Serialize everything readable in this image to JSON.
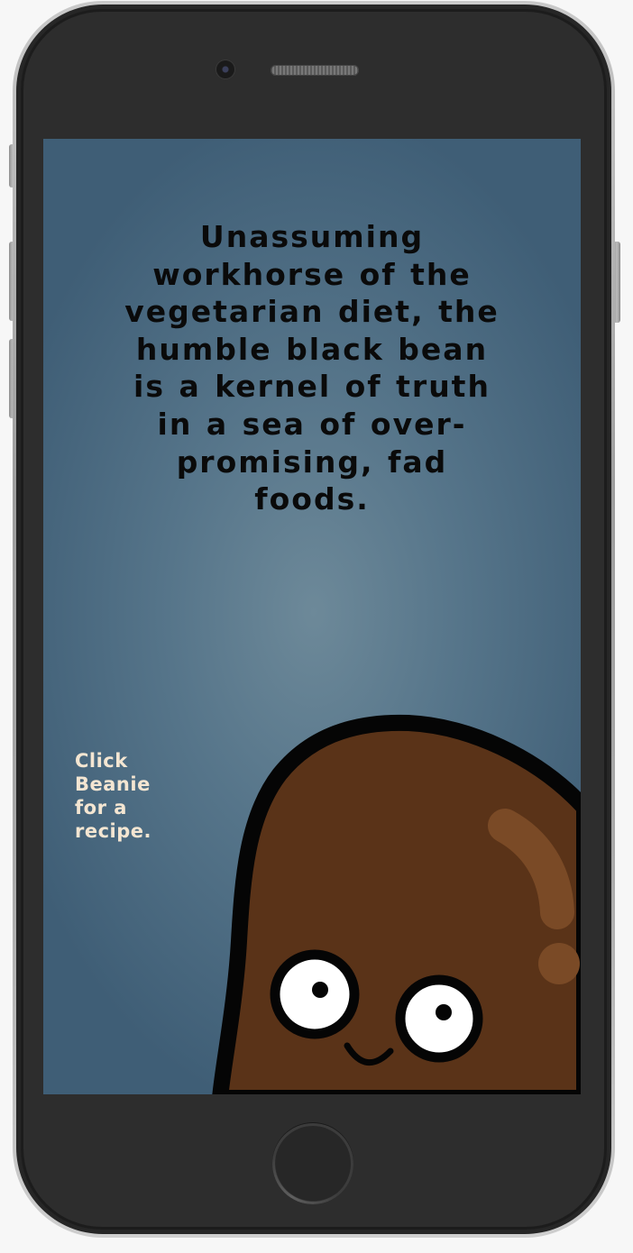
{
  "device": {
    "type": "phone-mockup"
  },
  "screen": {
    "quote_text": "Unassuming workhorse of the vegetarian diet, the humble black bean is a kernel of truth in a sea of over-promising, fad foods.",
    "hint_text": "Click Beanie for a recipe.",
    "colors": {
      "background_center": "#6d8999",
      "background_edge": "#3f5e76",
      "quote_text": "#0a0a0a",
      "hint_text": "#f4e6d2",
      "bean_body": "#5a3318",
      "bean_outline": "#050505",
      "bean_highlight": "#7a4a26"
    }
  },
  "icons": {
    "beanie": "beanie-character-icon",
    "camera": "front-camera-icon",
    "speaker": "earpiece-speaker-icon",
    "home": "home-button-icon"
  }
}
